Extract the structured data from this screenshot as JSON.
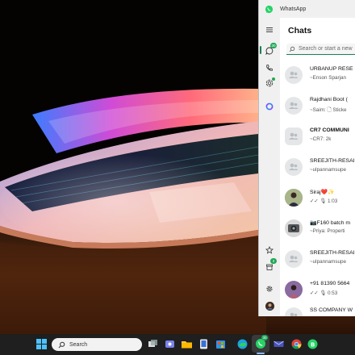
{
  "app": {
    "title": "WhatsApp"
  },
  "rail": {
    "chats_badge": "30",
    "communities_badge": "3"
  },
  "main": {
    "heading": "Chats",
    "search_placeholder": "Search or start a new"
  },
  "chats": [
    {
      "name": "URBANUP RESE",
      "preview": "~Enson Sparjan"
    },
    {
      "name": "Rajdhani Boot (",
      "preview": "~Saim: 🗋 Sticke"
    },
    {
      "name": "CR7 COMMUNI",
      "preview": "~CR7: 2k"
    },
    {
      "name": "SREEJITH-RESAI",
      "preview": "~ulpannamsupe"
    },
    {
      "name": "Siraj❤️✨",
      "preview": "✓✓ 🎙 1:03"
    },
    {
      "name": "📷F160 batch m",
      "preview": "~Priya: Properti"
    },
    {
      "name": "SREEJITH-RESAI",
      "preview": "~ulpannamsupe"
    },
    {
      "name": "+91 81390 5664",
      "preview": "✓✓ 🎙 0:53"
    },
    {
      "name": "SS COMPANY W",
      "preview": ""
    }
  ],
  "taskbar": {
    "search_label": "Search",
    "whatsapp_badge": "30"
  },
  "colors": {
    "accent": "#1a7f55",
    "badge": "#1fa855",
    "taskbar": "#1f1f1f"
  }
}
